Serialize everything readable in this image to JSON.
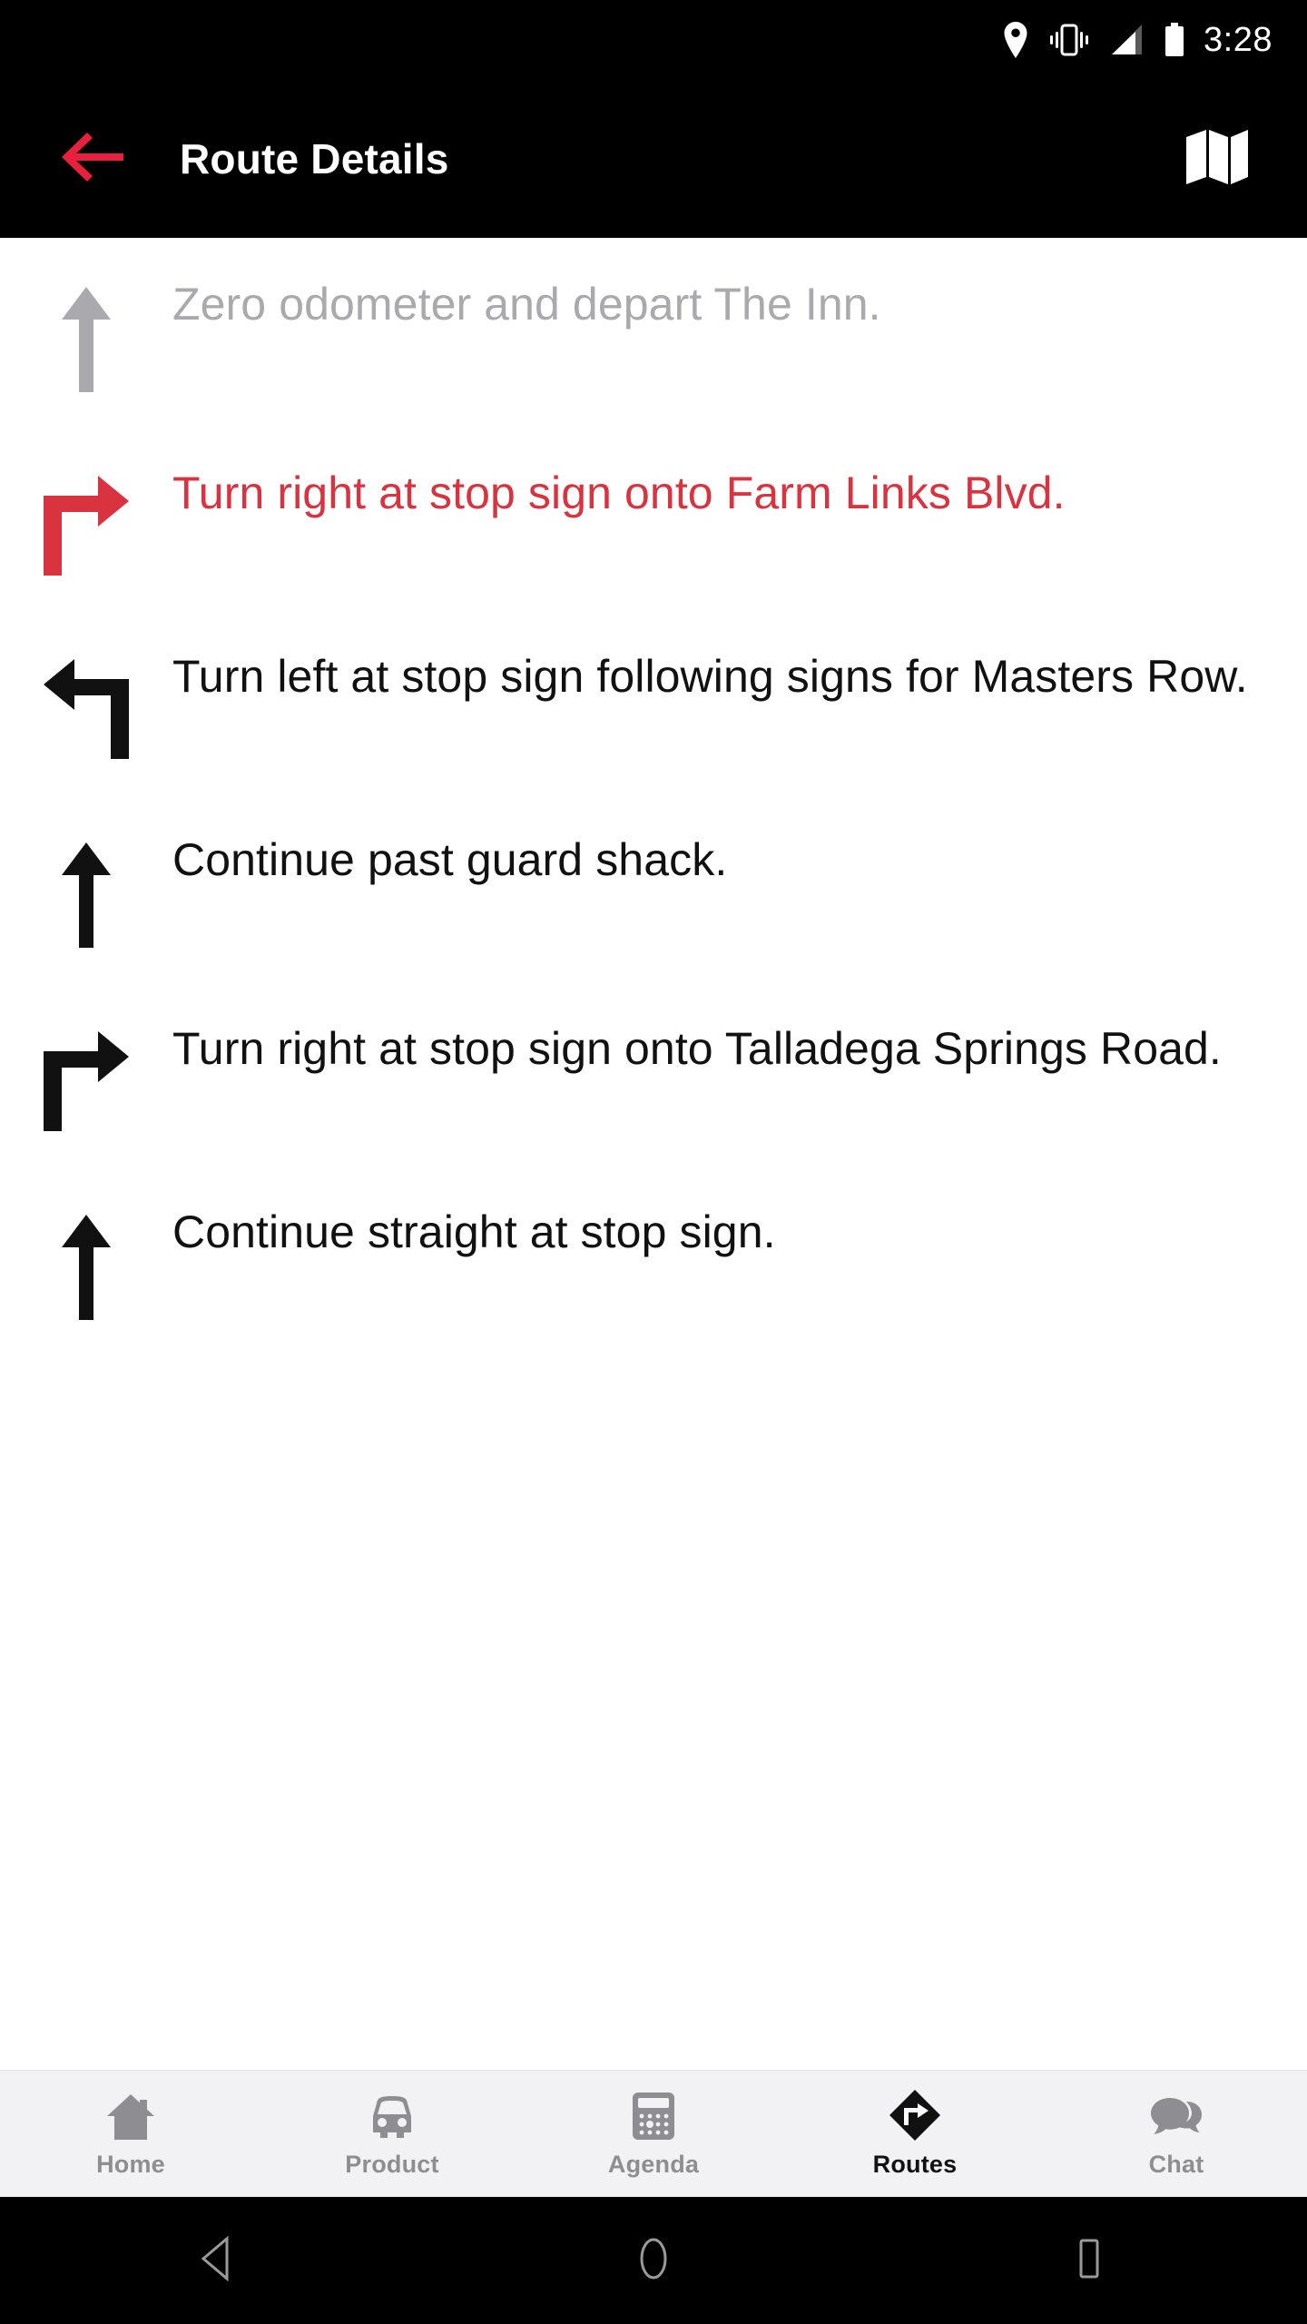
{
  "status_bar": {
    "time": "3:28",
    "icons": [
      "location-pin-icon",
      "vibrate-icon",
      "signal-icon",
      "battery-icon"
    ]
  },
  "app_bar": {
    "title": "Route Details",
    "back_icon": "back-arrow-icon",
    "map_icon": "map-icon",
    "back_color": "#e8203d",
    "background": "#000000",
    "title_color": "#ffffff"
  },
  "route_steps": [
    {
      "icon": "arrow-straight-icon",
      "text": "Zero odometer and depart The Inn.",
      "state": "done",
      "color": "#aaaaae"
    },
    {
      "icon": "arrow-turn-right-icon",
      "text": "Turn right at stop sign onto Farm Links Blvd.",
      "state": "active",
      "color": "#d93340"
    },
    {
      "icon": "arrow-turn-left-icon",
      "text": "Turn left at stop sign following signs for Masters Row.",
      "state": "normal",
      "color": "#111111"
    },
    {
      "icon": "arrow-straight-icon",
      "text": "Continue past guard shack.",
      "state": "normal",
      "color": "#111111"
    },
    {
      "icon": "arrow-turn-right-icon",
      "text": "Turn right at stop sign onto Talladega Springs Road.",
      "state": "normal",
      "color": "#111111"
    },
    {
      "icon": "arrow-straight-icon",
      "text": "Continue straight at stop sign.",
      "state": "normal",
      "color": "#111111"
    }
  ],
  "tab_bar": {
    "background": "#f2f2f4",
    "inactive_color": "#8d8d92",
    "active_color": "#111111",
    "tabs": [
      {
        "label": "Home",
        "icon": "home-icon",
        "active": false
      },
      {
        "label": "Product",
        "icon": "car-icon",
        "active": false
      },
      {
        "label": "Agenda",
        "icon": "calculator-icon",
        "active": false
      },
      {
        "label": "Routes",
        "icon": "route-sign-icon",
        "active": true
      },
      {
        "label": "Chat",
        "icon": "chat-bubbles-icon",
        "active": false
      }
    ]
  },
  "android_nav": {
    "back": "nav-back-icon",
    "home": "nav-home-icon",
    "recents": "nav-recents-icon"
  }
}
